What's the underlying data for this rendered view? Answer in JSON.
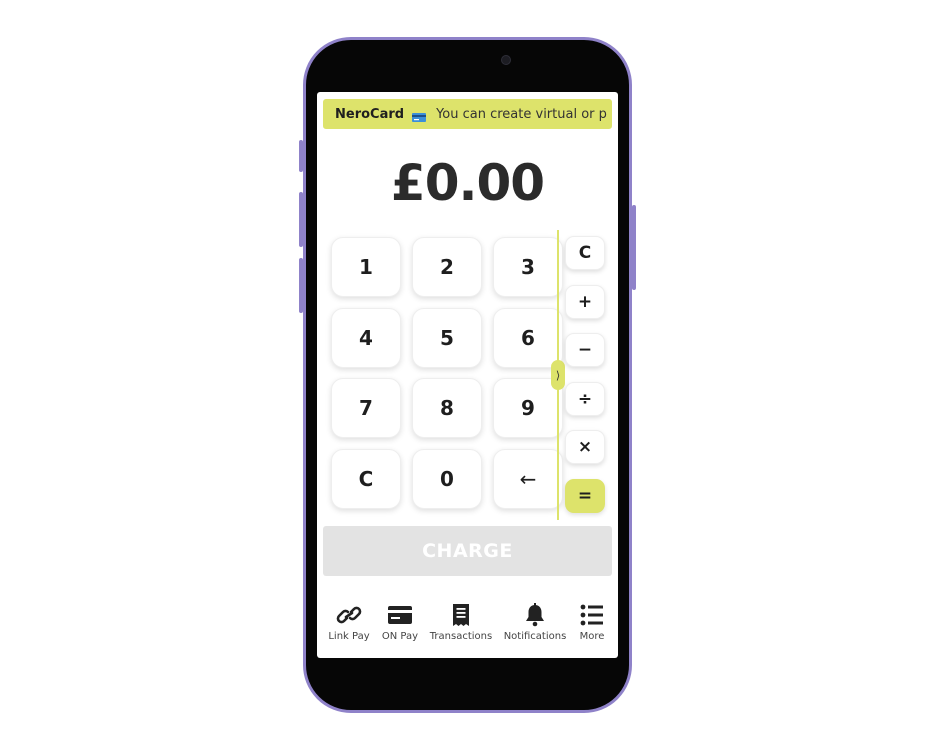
{
  "banner": {
    "brand": "NeroCard",
    "marquee_text": "You can create virtual or p"
  },
  "amount": "£0.00",
  "keypad": {
    "keys": [
      "1",
      "2",
      "3",
      "4",
      "5",
      "6",
      "7",
      "8",
      "9",
      "C",
      "0",
      "←"
    ]
  },
  "operators": {
    "keys": [
      "C",
      "+",
      "−",
      "÷",
      "×",
      "="
    ]
  },
  "panel_toggle": "⟩",
  "charge_label": "CHARGE",
  "nav": {
    "items": [
      {
        "label": "Link Pay",
        "icon": "link-icon"
      },
      {
        "label": "ON Pay",
        "icon": "card-icon"
      },
      {
        "label": "Transactions",
        "icon": "receipt-icon"
      },
      {
        "label": "Notifications",
        "icon": "bell-icon"
      },
      {
        "label": "More",
        "icon": "list-icon"
      }
    ]
  },
  "colors": {
    "accent": "#dde36b",
    "phone_frame": "#8f82c9",
    "charge_disabled": "#e3e3e3"
  }
}
